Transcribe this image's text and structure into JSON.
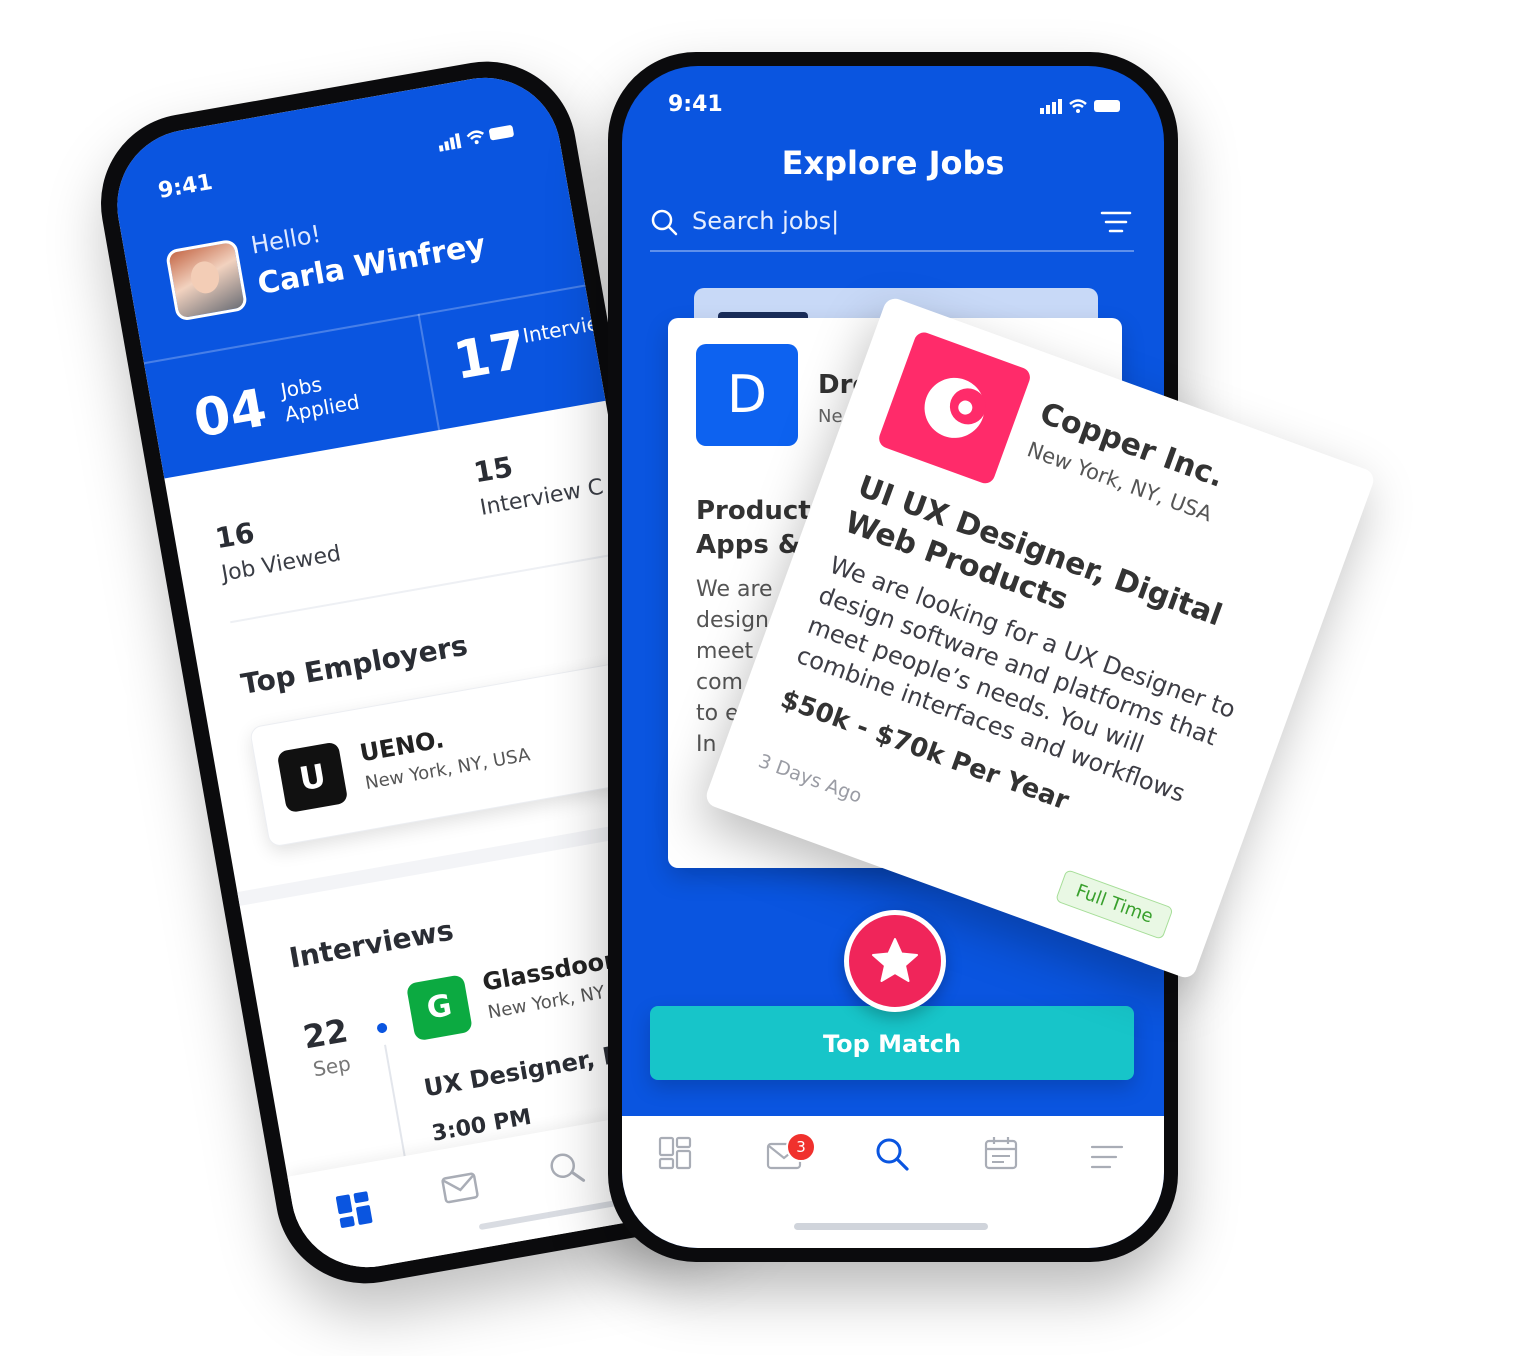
{
  "left_phone": {
    "status": {
      "time": "9:41"
    },
    "header": {
      "greeting": "Hello!",
      "user_name": "Carla Winfrey"
    },
    "stats_top": [
      {
        "value": "04",
        "label": "Jobs Applied"
      },
      {
        "value": "17",
        "label": "Interview Scheduled"
      }
    ],
    "stats_bottom": [
      {
        "value": "16",
        "label": "Job Viewed"
      },
      {
        "value": "15",
        "label": "Interview C"
      }
    ],
    "top_employers": {
      "title": "Top Employers",
      "items": [
        {
          "logo_letter": "U",
          "name": "UENO.",
          "location": "New York, NY, USA"
        }
      ]
    },
    "interviews": {
      "title": "Interviews",
      "items": [
        {
          "day": "22",
          "month": "Sep",
          "logo_letter": "G",
          "company": "Glassdoor",
          "location": "New York, NY",
          "job": "UX Designer, Dig",
          "time": "3:00 PM"
        }
      ]
    },
    "nav": [
      "dashboard-icon",
      "mail-icon",
      "search-icon"
    ]
  },
  "right_phone": {
    "status": {
      "time": "9:41"
    },
    "title": "Explore Jobs",
    "search": {
      "placeholder": "Search jobs|"
    },
    "back_card": {
      "logo_letter": "D",
      "company": "Dro",
      "location": "Ne",
      "job_title": "Product \nApps &",
      "description": "We are\ndesign\nmeet\ncom\nto e\nIn"
    },
    "top_match_label": "Top Match",
    "nav": {
      "items": [
        "dashboard-icon",
        "mail-icon",
        "search-icon",
        "calendar-icon",
        "menu-icon"
      ],
      "mail_badge": "3",
      "active_color": "#0a55e0",
      "inactive_color": "#a9adb6"
    }
  },
  "floating_card": {
    "company": "Copper Inc.",
    "location": "New York, NY, USA",
    "job_title": "UI UX Designer, Digital Web Products",
    "description": "We are looking for a UX Designer to design software and platforms that meet people’s needs. You will combine interfaces and workflows",
    "salary": "$50k - $70k Per Year",
    "posted": "3 Days Ago",
    "type_badge": "Full Time",
    "logo_color": "#ff2b6a"
  },
  "colors": {
    "brand_blue": "#0a55e0",
    "teal": "#17c5c9",
    "pink": "#f0255a"
  }
}
